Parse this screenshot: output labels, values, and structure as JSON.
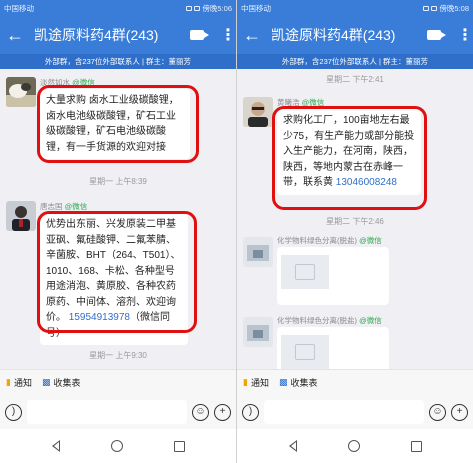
{
  "colors": {
    "header": "#3a7dd8",
    "subheader": "#2f6fc9",
    "highlight_frame": "#e01010",
    "wechat_tag": "#2fa84f",
    "link": "#2f6fc9",
    "chat_bg": "#efeff4"
  },
  "left": {
    "status": {
      "carrier": "中国移动",
      "battery_time": "傍晚5:06"
    },
    "header": {
      "title": "凯途原料药4群(243)",
      "subtitle": "外部群，含237位外部联系人 | 群主：董丽芳"
    },
    "messages": [
      {
        "sender": "淡然如水",
        "tag": "@微信",
        "text": "大量求购 卤水工业级碳酸锂，卤水电池级碳酸锂，矿石工业级碳酸锂，矿石电池级碳酸锂，有一手货源的欢迎对接"
      },
      {
        "time": "星期一 上午8:39"
      },
      {
        "sender": "唐志国",
        "tag": "@微信",
        "text": "优势出东丽、兴发原装二甲基亚砜、氟硅酸钾、二氟苯腈、辛菌胺、BHT（264、T501）、1010、168、卡松、各种型号用途消泡、黄原胶、各种农药原药、中间体、溶剂、欢迎询价。",
        "phone": "15954913978",
        "phone_note": "（微信同号）"
      },
      {
        "time": "星期一 上午9:30"
      }
    ],
    "quickbar": {
      "notice": "通知",
      "form": "收集表"
    }
  },
  "right": {
    "status": {
      "carrier": "中国移动",
      "battery_time": "傍晚5:08"
    },
    "header": {
      "title": "凯途原料药4群(243)",
      "subtitle": "外部群，含237位外部联系人 | 群主：董丽芳"
    },
    "messages": [
      {
        "time": "星期二 下午2:41"
      },
      {
        "sender": "黄曦浩",
        "tag": "@微信",
        "text": "求购化工厂，100亩地左右最少75，有生产能力或部分能投入生产能力，在河南，陕西，陕西，等地内蒙古在赤峰一带，联系黄",
        "phone": "13046008248"
      },
      {
        "time": "星期二 下午2:46"
      },
      {
        "sender": "化学物料绿色分离(脱盐)",
        "tag": "@微信"
      },
      {
        "sender": "化学物料绿色分离(脱盐)",
        "tag": "@微信"
      }
    ],
    "quickbar": {
      "notice": "通知",
      "form": "收集表"
    }
  },
  "icons": [
    "back-arrow-icon",
    "video-call-icon",
    "more-vertical-icon",
    "voice-icon",
    "emoji-icon",
    "plus-icon",
    "notice-icon",
    "form-icon",
    "nav-back-icon",
    "nav-home-icon",
    "nav-recent-icon",
    "image-placeholder-icon"
  ]
}
